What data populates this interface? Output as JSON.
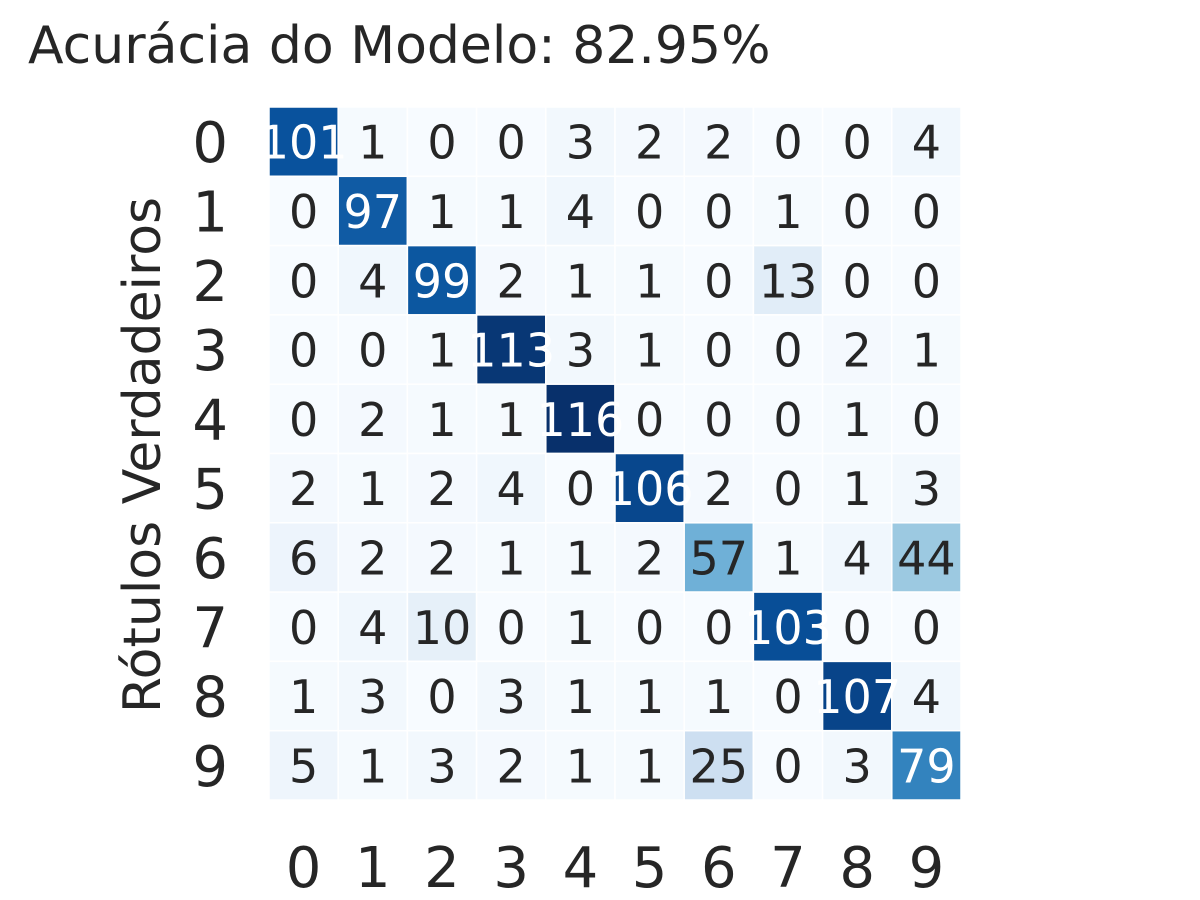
{
  "chart_data": {
    "type": "heatmap",
    "title": "Acurácia do Modelo: 82.95%",
    "ylabel": "Rótulos Verdadeiros",
    "xlabel": "",
    "x_categories": [
      "0",
      "1",
      "2",
      "3",
      "4",
      "5",
      "6",
      "7",
      "8",
      "9"
    ],
    "y_categories": [
      "0",
      "1",
      "2",
      "3",
      "4",
      "5",
      "6",
      "7",
      "8",
      "9"
    ],
    "colormap": "Blues",
    "value_range": [
      0,
      116
    ],
    "matrix": [
      [
        101,
        1,
        0,
        0,
        3,
        2,
        2,
        0,
        0,
        4
      ],
      [
        0,
        97,
        1,
        1,
        4,
        0,
        0,
        1,
        0,
        0
      ],
      [
        0,
        4,
        99,
        2,
        1,
        1,
        0,
        13,
        0,
        0
      ],
      [
        0,
        0,
        1,
        113,
        3,
        1,
        0,
        0,
        2,
        1
      ],
      [
        0,
        2,
        1,
        1,
        116,
        0,
        0,
        0,
        1,
        0
      ],
      [
        2,
        1,
        2,
        4,
        0,
        106,
        2,
        0,
        1,
        3
      ],
      [
        6,
        2,
        2,
        1,
        1,
        2,
        57,
        1,
        4,
        44
      ],
      [
        0,
        4,
        10,
        0,
        1,
        0,
        0,
        103,
        0,
        0
      ],
      [
        1,
        3,
        0,
        3,
        1,
        1,
        1,
        0,
        107,
        4
      ],
      [
        5,
        1,
        3,
        2,
        1,
        1,
        25,
        0,
        3,
        79
      ]
    ],
    "colors": {
      "text_dark": "#262626",
      "text_light": "#ffffff",
      "cell_border": "#ffffff"
    }
  }
}
